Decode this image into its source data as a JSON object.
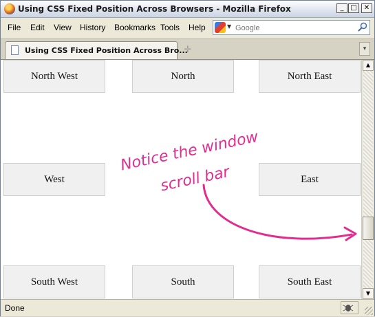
{
  "window": {
    "title": "Using CSS Fixed Position Across Browsers - Mozilla Firefox"
  },
  "menu": [
    "File",
    "Edit",
    "View",
    "History",
    "Bookmarks",
    "Tools",
    "Help"
  ],
  "search": {
    "placeholder": "Google",
    "engine_icon": "google-icon"
  },
  "tabs": [
    {
      "label": "Using CSS Fixed Position Across Bro..."
    }
  ],
  "cells": {
    "north_west": "North West",
    "north": "North",
    "north_east": "North East",
    "west": "West",
    "east": "East",
    "south_west": "South West",
    "south": "South",
    "south_east": "South East"
  },
  "annotation": {
    "line1": "Notice the window",
    "line2": "scroll bar",
    "color": "#e32c8f"
  },
  "status": {
    "text": "Done"
  }
}
